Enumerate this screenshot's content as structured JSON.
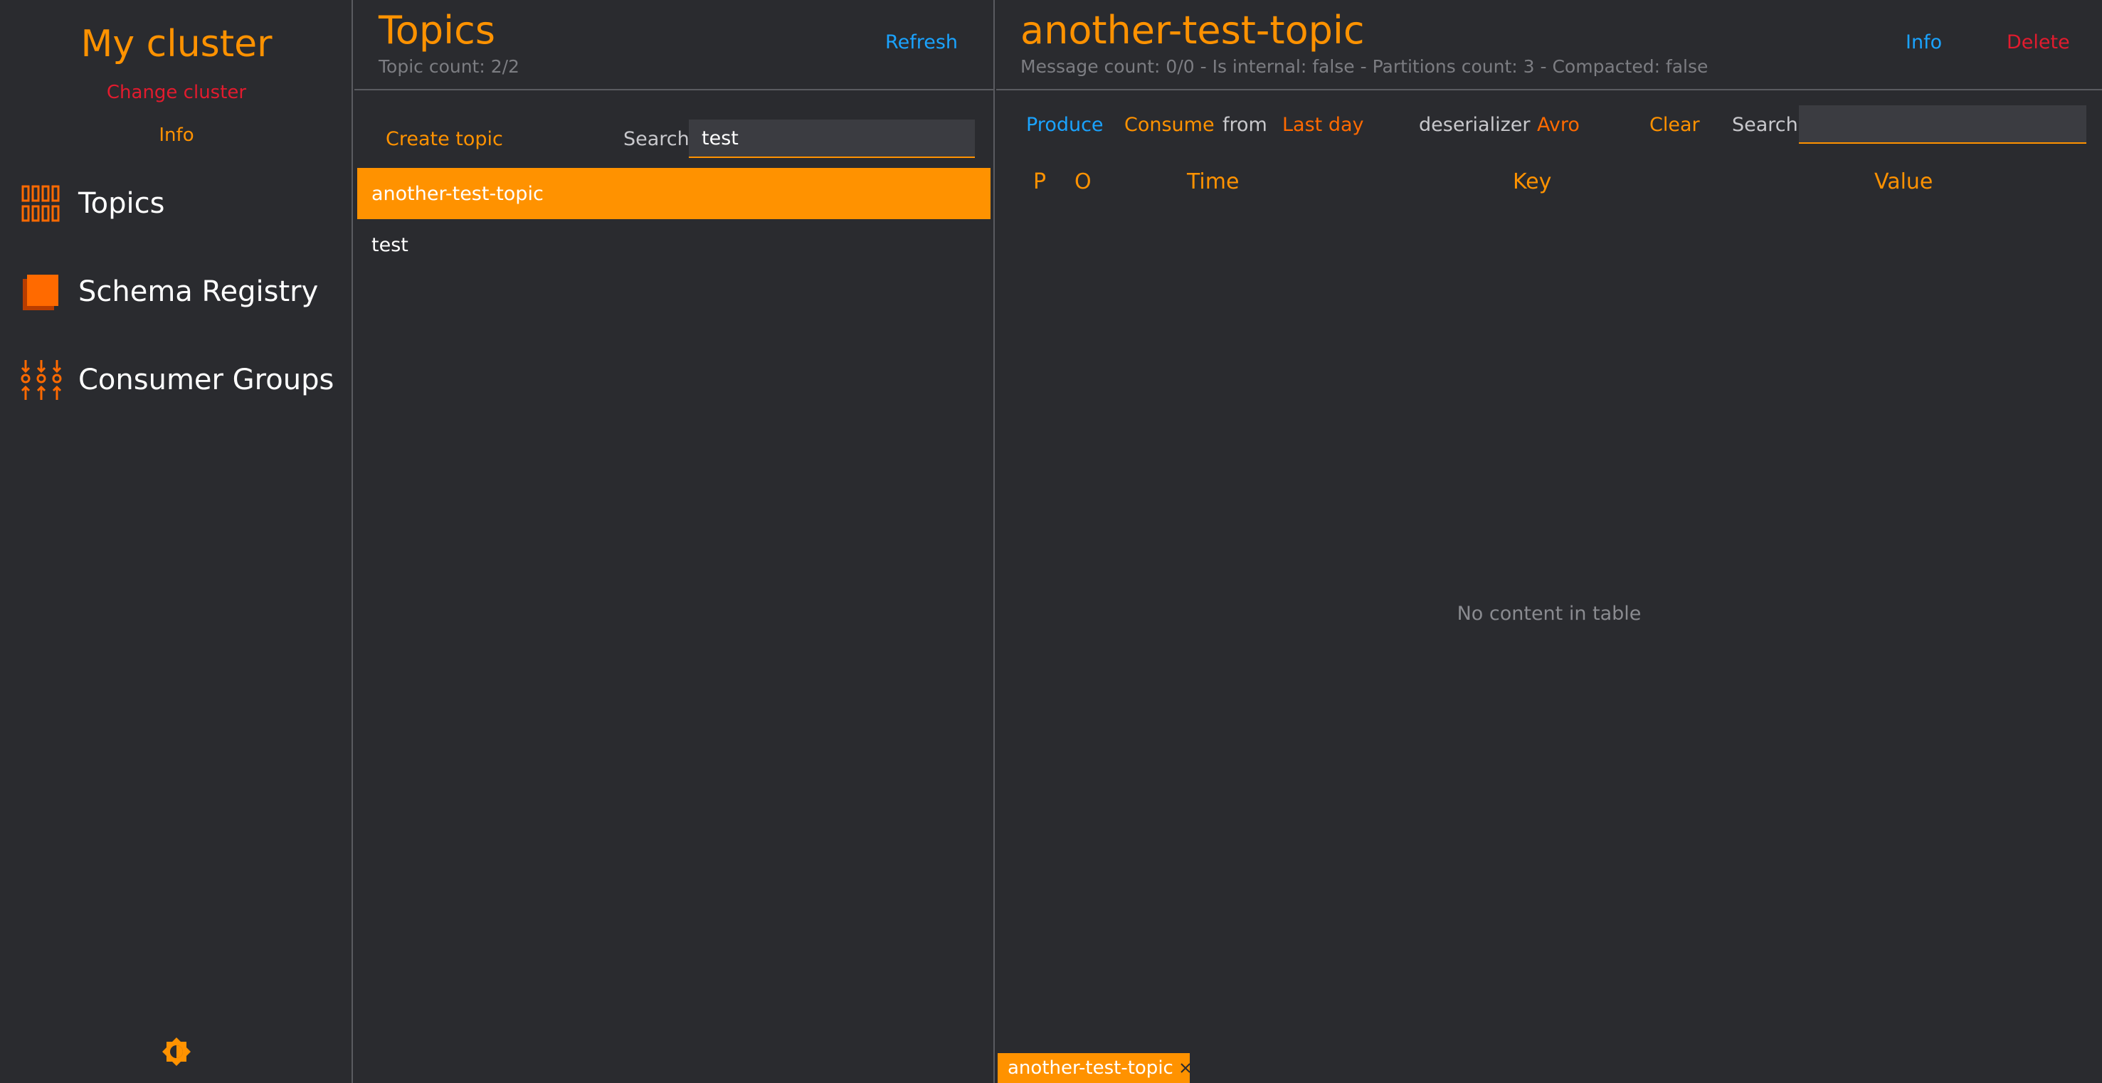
{
  "sidebar": {
    "cluster_title": "My cluster",
    "change_cluster": "Change cluster",
    "info": "Info",
    "nav": [
      {
        "label": "Topics",
        "icon": "topics-icon"
      },
      {
        "label": "Schema Registry",
        "icon": "schema-registry-icon"
      },
      {
        "label": "Consumer Groups",
        "icon": "consumer-groups-icon"
      }
    ],
    "theme_icon": "theme-toggle-icon"
  },
  "topics": {
    "title": "Topics",
    "count_text": "Topic count: 2/2",
    "refresh": "Refresh",
    "create_topic": "Create topic",
    "search_label": "Search",
    "search_value": "test",
    "items": [
      {
        "name": "another-test-topic",
        "selected": true
      },
      {
        "name": "test",
        "selected": false
      }
    ]
  },
  "detail": {
    "title": "another-test-topic",
    "meta": "Message count: 0/0 - Is internal: false - Partitions count: 3 - Compacted: false",
    "info": "Info",
    "delete": "Delete",
    "toolbar": {
      "produce": "Produce",
      "consume": "Consume",
      "from": "from",
      "range": "Last day",
      "deserializer_label": "deserializer",
      "deserializer_value": "Avro",
      "clear": "Clear",
      "search_label": "Search",
      "search_value": ""
    },
    "columns": [
      "P",
      "O",
      "Time",
      "Key",
      "Value"
    ],
    "empty_text": "No content in table",
    "open_tab": "another-test-topic"
  },
  "colors": {
    "accent": "#ff9200",
    "link": "#1aa3ff",
    "danger": "#e21b2e",
    "background": "#2a2b2f"
  }
}
